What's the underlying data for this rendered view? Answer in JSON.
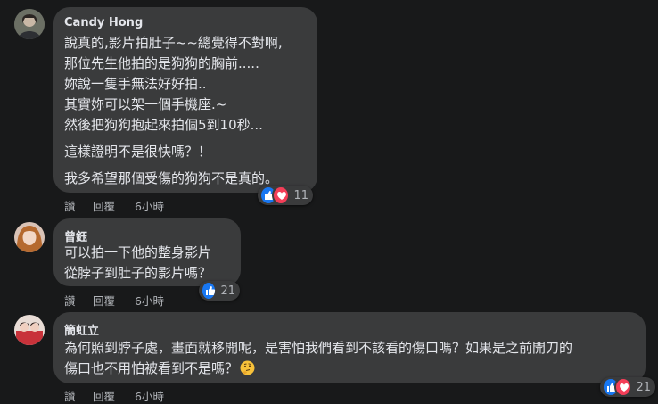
{
  "colors": {
    "background": "#18191a",
    "bubble": "#3a3b3c",
    "text": "#e4e6eb",
    "secondary_text": "#b0b3b8",
    "like_blue": "#1877f2",
    "love_red": "#f33e58"
  },
  "comments": [
    {
      "author": "Candy Hong",
      "lines": [
        "說真的,影片拍肚子~~總覺得不對啊,",
        "那位先生他拍的是狗狗的胸前.....",
        "妳說一隻手無法好好拍..",
        "其實妳可以架一個手機座.~",
        "然後把狗狗抱起來拍個5到10秒...",
        "這樣證明不是很快嗎？！",
        "我多希望那個受傷的狗狗不是真的。"
      ],
      "actions": {
        "like": "讚",
        "reply": "回覆",
        "time": "6小時"
      },
      "reactions": {
        "icons": [
          "like-icon",
          "love-icon"
        ],
        "count": "11"
      }
    },
    {
      "author": "曾鈺",
      "lines": [
        "可以拍一下他的整身影片",
        "從脖子到肚子的影片嗎？"
      ],
      "actions": {
        "like": "讚",
        "reply": "回覆",
        "time": "6小時"
      },
      "reactions": {
        "icons": [
          "like-icon"
        ],
        "count": "21"
      }
    },
    {
      "author": "簡虹立",
      "lines": [
        "為何照到脖子處，畫面就移開呢，是害怕我們看到不該看的傷口嗎？如果是之前開刀的",
        "傷口也不用怕被看到不是嗎？"
      ],
      "emoji": "thinking-face-icon",
      "actions": {
        "like": "讚",
        "reply": "回覆",
        "time": "6小時"
      },
      "reactions": {
        "icons": [
          "like-icon",
          "love-icon"
        ],
        "count": "21"
      }
    }
  ]
}
